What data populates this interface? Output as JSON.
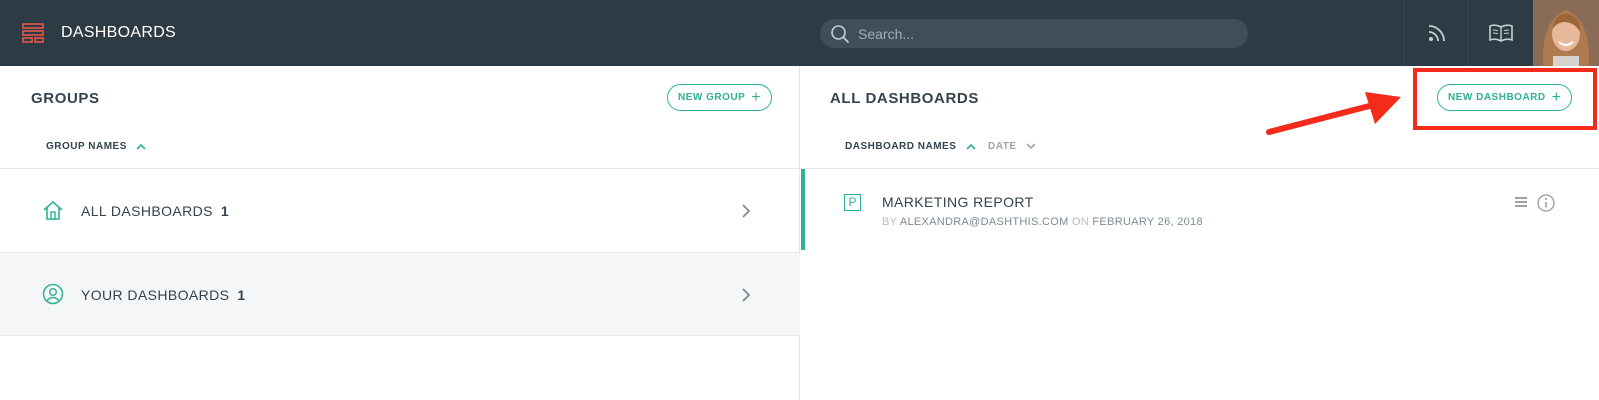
{
  "header": {
    "title": "DASHBOARDS",
    "search_placeholder": "Search..."
  },
  "groups_panel": {
    "title": "GROUPS",
    "new_group_label": "NEW GROUP",
    "sort_label": "GROUP NAMES",
    "groups": [
      {
        "label": "ALL DASHBOARDS",
        "count": "1",
        "icon": "home-icon"
      },
      {
        "label": "YOUR DASHBOARDS",
        "count": "1",
        "icon": "user-circle-icon"
      }
    ]
  },
  "dashboards_panel": {
    "title": "ALL DASHBOARDS",
    "new_dashboard_label": "NEW DASHBOARD",
    "sort_names_label": "DASHBOARD NAMES",
    "sort_date_label": "DATE",
    "items": [
      {
        "icon_letter": "P",
        "title": "MARKETING REPORT",
        "by_label": "BY",
        "author": "ALEXANDRA@DASHTHIS.COM",
        "on_label": "ON",
        "date": "FEBRUARY 26, 2018"
      }
    ]
  },
  "colors": {
    "topbar": "#2d3b45",
    "accent": "#2fb196",
    "annotation": "#f42a1b",
    "logo": "#e5574a"
  }
}
